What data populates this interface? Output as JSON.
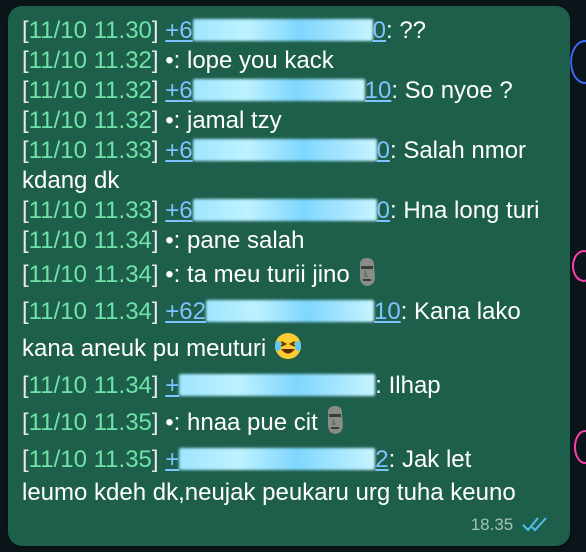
{
  "chat": {
    "messages": [
      {
        "time": "11/10 11.30",
        "sender_prefix": "+6",
        "sender_suffix": "0",
        "text": ": ??"
      },
      {
        "time": "11/10 11.32",
        "sender_prefix": "•",
        "sender_suffix": "",
        "text": ": lope you kack"
      },
      {
        "time": "11/10 11.32",
        "sender_prefix": "+6",
        "sender_suffix": "10",
        "text": ": So nyoe ?"
      },
      {
        "time": "11/10 11.32",
        "sender_prefix": "•",
        "sender_suffix": "",
        "text": ": jamal tzy"
      },
      {
        "time": "11/10 11.33",
        "sender_prefix": "+6",
        "sender_suffix": "0",
        "text": ": Salah nmor"
      },
      {
        "continuation": "kdang dk"
      },
      {
        "time": "11/10 11.33",
        "sender_prefix": "+6",
        "sender_suffix": "0",
        "text": ": Hna long turi"
      },
      {
        "time": "11/10 11.34",
        "sender_prefix": "•",
        "sender_suffix": "",
        "text": ": pane salah"
      },
      {
        "time": "11/10 11.34",
        "sender_prefix": "•",
        "sender_suffix": "",
        "text": ": ta meu turii jino"
      },
      {
        "time": "11/10 11.34",
        "sender_prefix": "+62",
        "sender_suffix": "10",
        "text": ": Kana lako"
      },
      {
        "continuation": "kana aneuk pu meuturi"
      },
      {
        "time": "11/10 11.34",
        "sender_prefix": "+",
        "sender_suffix": "",
        "text": ": Ilhap"
      },
      {
        "time": "11/10 11.35",
        "sender_prefix": "•",
        "sender_suffix": "",
        "text": ": hnaa pue cit"
      },
      {
        "time": "11/10 11.35",
        "sender_prefix": "+",
        "sender_suffix": "2",
        "text": ": Jak let"
      },
      {
        "continuation": "leumo kdeh dk,neujak peukaru urg tuha keuno"
      }
    ],
    "timestamp": "18.35",
    "colors": {
      "bubble": "#1e5f4c",
      "timestamp_text": "#6fe3a8",
      "sender_link": "#7cc3ff",
      "read_ticks": "#53bdeb"
    }
  }
}
